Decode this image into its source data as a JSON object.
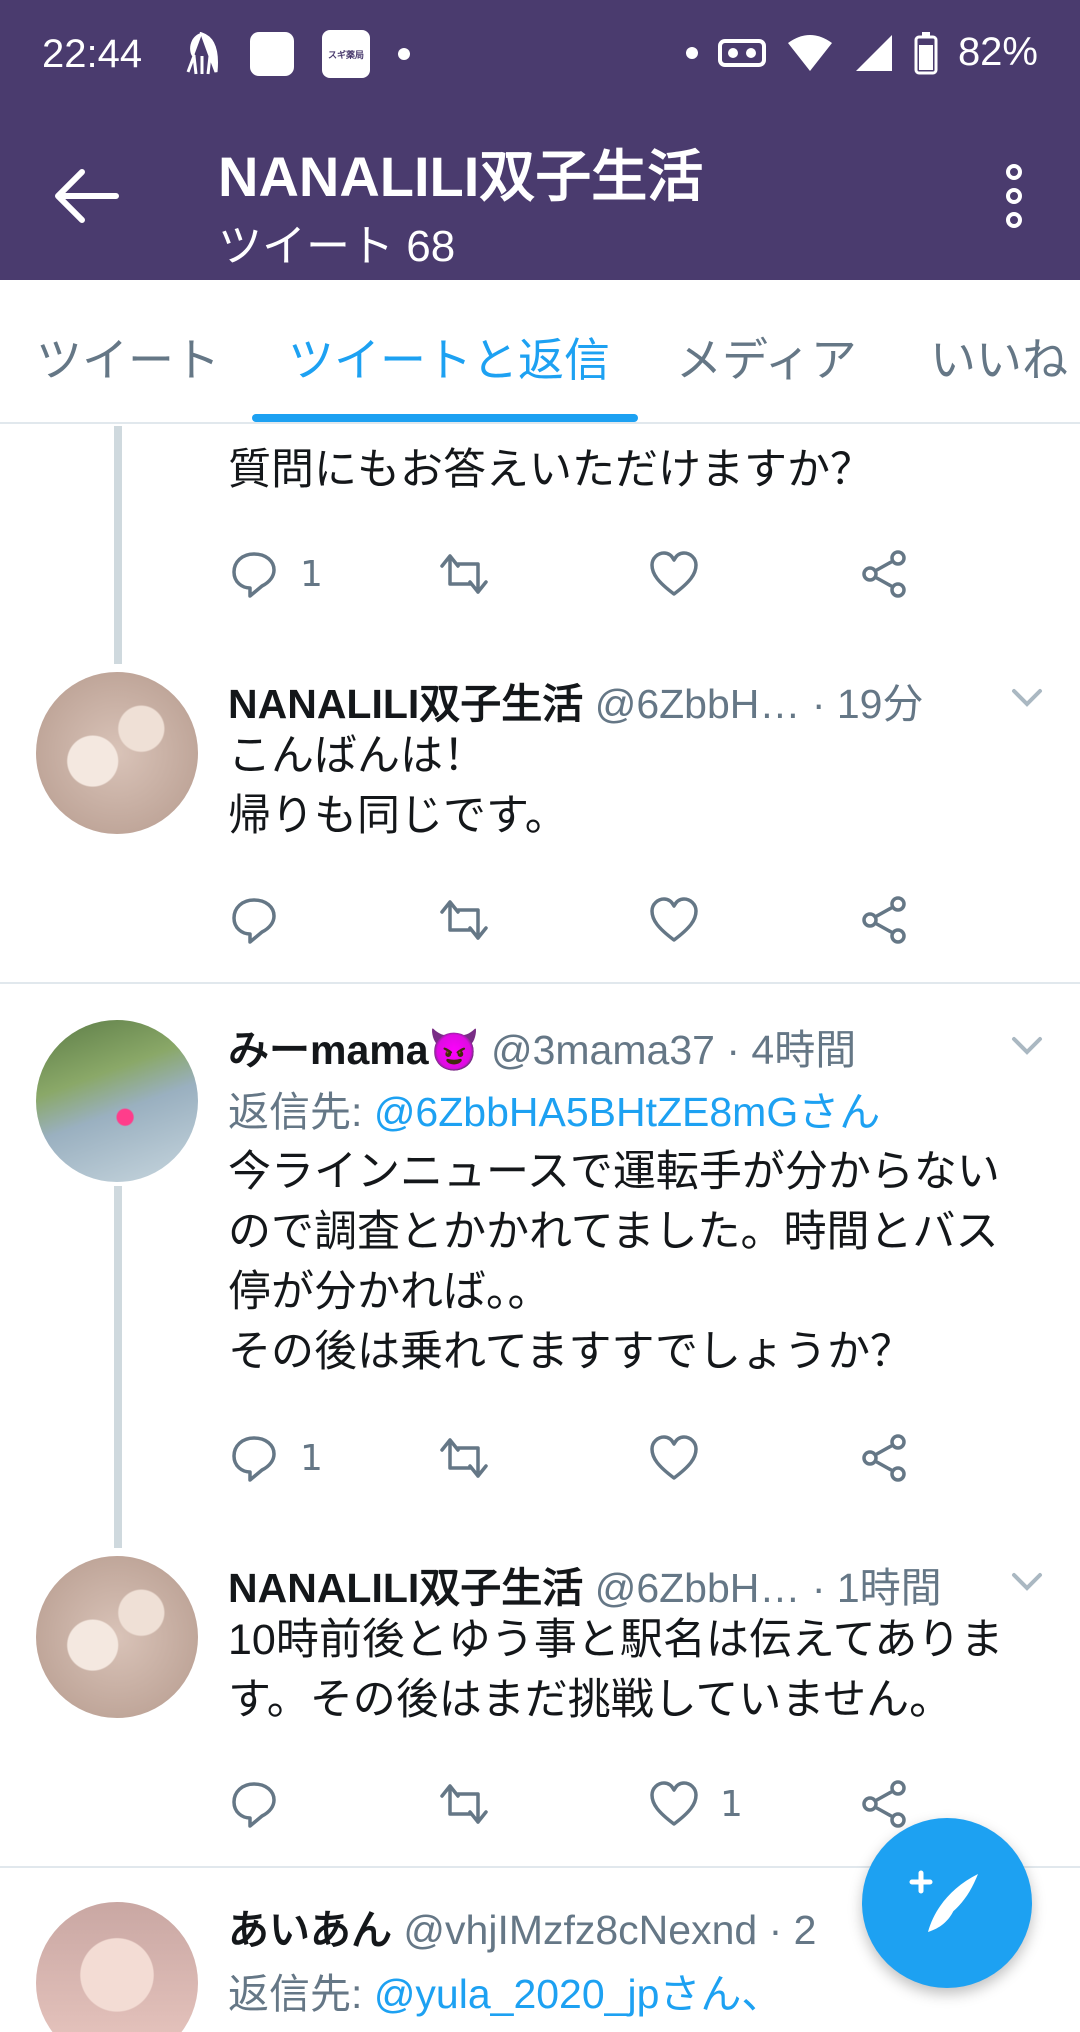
{
  "status_bar": {
    "time": "22:44",
    "battery": "82%",
    "left_icons": [
      "squid-icon",
      "square-icon",
      "app-badge-icon",
      "dot-icon"
    ],
    "right_icons": [
      "dot-icon",
      "vr-icon",
      "wifi-icon",
      "signal-icon",
      "battery-icon"
    ],
    "app_badge_text": "スギ薬局"
  },
  "header": {
    "title": "NANALILI双子生活",
    "subtitle": "ツイート 68"
  },
  "tabs": [
    {
      "label": "ツイート",
      "active": false
    },
    {
      "label": "ツイートと返信",
      "active": true
    },
    {
      "label": "メディア",
      "active": false
    },
    {
      "label": "いいね",
      "active": false
    }
  ],
  "tweets": [
    {
      "text": "質問にもお答えいただけますか？",
      "reply_count": "1",
      "retweet_count": "",
      "like_count": ""
    },
    {
      "name": "NANALILI双子生活",
      "handle": "@6ZbbH…",
      "time": "· 19分",
      "text_lines": [
        "こんばんは！",
        "帰りも同じです。"
      ],
      "reply_count": "",
      "retweet_count": "",
      "like_count": ""
    },
    {
      "name": "みーmama😈",
      "handle": "@3mama37",
      "time": "· 4時間",
      "reply_prefix": "返信先:",
      "reply_to": "@6ZbbHA5BHtZE8mGさん",
      "text_lines": [
        "今ラインニュースで運転手が分からない",
        "ので調査とかかれてました。時間とバス",
        "停が分かれば。。",
        "その後は乗れてますすでしょうか？"
      ],
      "reply_count": "1",
      "retweet_count": "",
      "like_count": ""
    },
    {
      "name": "NANALILI双子生活",
      "handle": "@6ZbbH…",
      "time": "· 1時間",
      "text_lines": [
        "10時前後とゆう事と駅名は伝えてありま",
        "す。その後はまだ挑戦していません。"
      ],
      "reply_count": "",
      "retweet_count": "",
      "like_count": "1"
    },
    {
      "name": "あいあん",
      "handle": "@vhjIMzfz8cNexnd",
      "time": "· 2",
      "reply_prefix": "返信先:",
      "reply_to": "@yula_2020_jpさん、"
    }
  ],
  "colors": {
    "header_bg": "#4a3b6e",
    "accent": "#1da1f2",
    "secondary_text": "#657786",
    "divider": "#e1e8ed"
  },
  "fab": {
    "icon": "compose-tweet-icon"
  }
}
